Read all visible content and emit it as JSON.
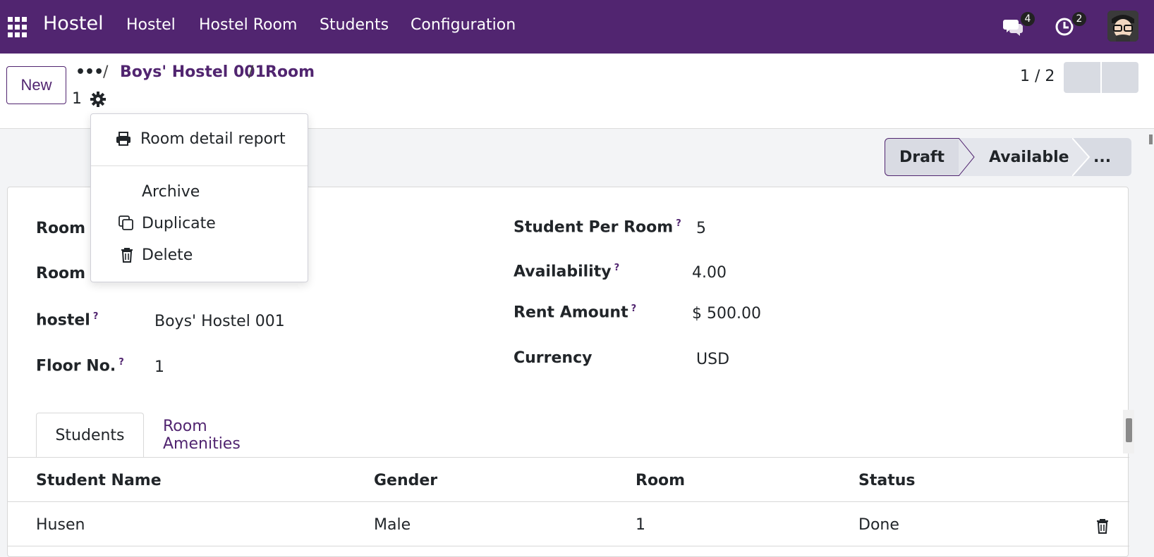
{
  "app": {
    "brand": "Hostel",
    "menu": [
      {
        "label": "Hostel"
      },
      {
        "label": "Hostel Room"
      },
      {
        "label": "Students"
      },
      {
        "label": "Configuration"
      }
    ],
    "messages_count": "4",
    "activities_count": "2",
    "icons": [
      "apps-grid-icon",
      "chat-icon",
      "clock-icon",
      "avatar"
    ]
  },
  "control": {
    "new_label": "New",
    "breadcrumb_dots": "•••",
    "breadcrumb_sep": "/",
    "breadcrumb": [
      "Boys' Hostel 001",
      "Room"
    ],
    "record_id": "1",
    "pager": "1 / 2"
  },
  "actions_menu": {
    "report": "Room detail report",
    "archive": "Archive",
    "duplicate": "Duplicate",
    "delete": "Delete"
  },
  "statusbar": {
    "stages": [
      "Draft",
      "Available",
      "..."
    ],
    "current": "Draft"
  },
  "form": {
    "left": [
      {
        "label": "Room N",
        "value": ""
      },
      {
        "label": "Room N",
        "value": ""
      },
      {
        "label": "hostel",
        "help": "?",
        "value": "Boys' Hostel 001"
      },
      {
        "label": "Floor No.",
        "help": "?",
        "value": "1"
      }
    ],
    "right": [
      {
        "label": "Student Per Room",
        "help": "?",
        "value": "5"
      },
      {
        "label": "Availability",
        "help": "?",
        "value": "4.00"
      },
      {
        "label": "Rent Amount",
        "help": "?",
        "value": "$ 500.00"
      },
      {
        "label": "Currency",
        "value": "USD"
      }
    ]
  },
  "tabs": [
    {
      "label": "Students",
      "active": true
    },
    {
      "label": "Room Amenities",
      "active": false
    }
  ],
  "students_table": {
    "columns": [
      "Student Name",
      "Gender",
      "Room",
      "Status"
    ],
    "rows": [
      {
        "name": "Husen",
        "gender": "Male",
        "room": "1",
        "status": "Done"
      }
    ]
  },
  "colors": {
    "primary": "#512570",
    "navbar": "#512570",
    "background": "#f3f4f6"
  }
}
